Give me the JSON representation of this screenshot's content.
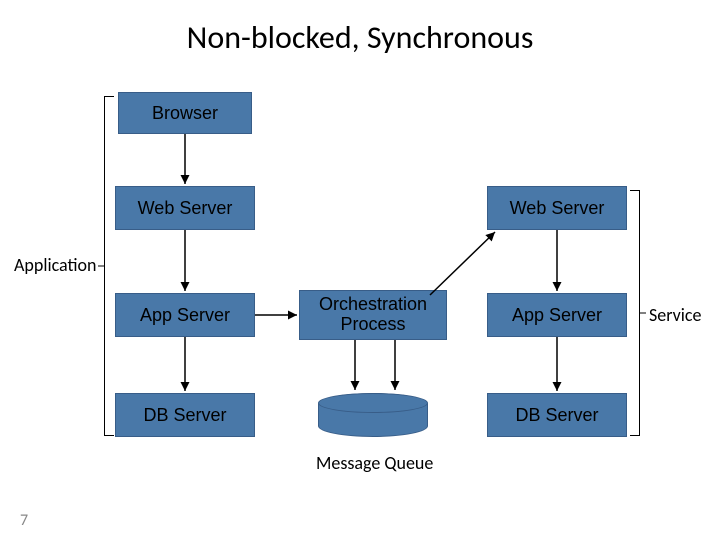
{
  "title": "Non-blocked, Synchronous",
  "boxes": {
    "browser": "Browser",
    "web_server_left": "Web Server",
    "web_server_right": "Web Server",
    "app_server_left": "App Server",
    "app_server_right": "App Server",
    "orchestration": "Orchestration\nProcess",
    "db_server_left": "DB Server",
    "db_server_right": "DB Server"
  },
  "labels": {
    "application": "Application",
    "service": "Service",
    "message_queue": "Message Queue"
  },
  "page_number": "7"
}
